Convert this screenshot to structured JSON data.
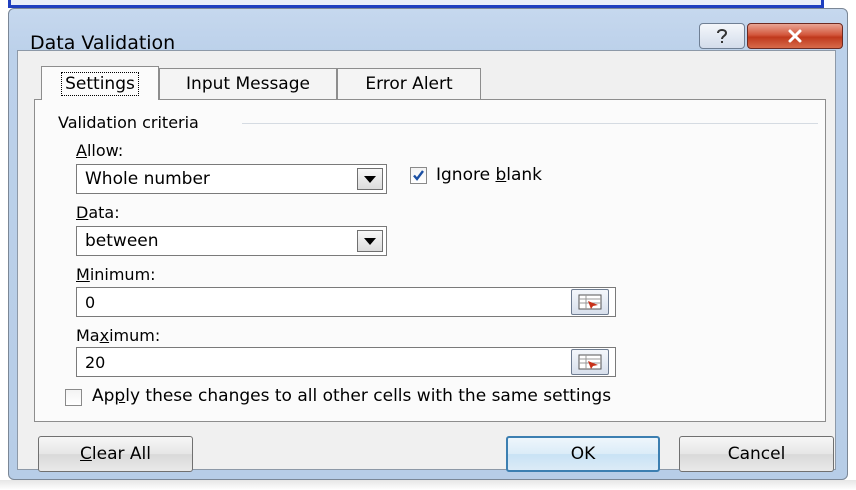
{
  "window": {
    "title": "Data Validation"
  },
  "title_buttons": {
    "help_icon": "question-icon",
    "close_icon": "close-x-icon"
  },
  "tabs": [
    {
      "label": "Settings",
      "active": true
    },
    {
      "label": "Input Message",
      "active": false
    },
    {
      "label": "Error Alert",
      "active": false
    }
  ],
  "settings": {
    "group_label": "Validation criteria",
    "allow": {
      "label_u": "A",
      "label_rest": "llow:",
      "value": "Whole number"
    },
    "ignore_blank": {
      "label_pre": "Ignore ",
      "label_u": "b",
      "label_post": "lank",
      "checked": true
    },
    "data": {
      "label_u": "D",
      "label_rest": "ata:",
      "value": "between"
    },
    "minimum": {
      "label_u": "M",
      "label_rest": "inimum:",
      "value": "0"
    },
    "maximum": {
      "label_pre": "Ma",
      "label_u": "x",
      "label_post": "imum:",
      "value": "20"
    },
    "apply_all": {
      "label_pre": "Ap",
      "label_u": "p",
      "label_post": "ly these changes to all other cells with the same settings",
      "checked": false
    }
  },
  "footer": {
    "clear_all": {
      "label_u": "C",
      "label_rest": "lear All"
    },
    "ok_label": "OK",
    "cancel_label": "Cancel"
  },
  "colors": {
    "title_gradient": "#bcd1ea",
    "close": "#c0391d",
    "default_button_border": "#3c7fb1",
    "check": "#1a4fa3"
  }
}
